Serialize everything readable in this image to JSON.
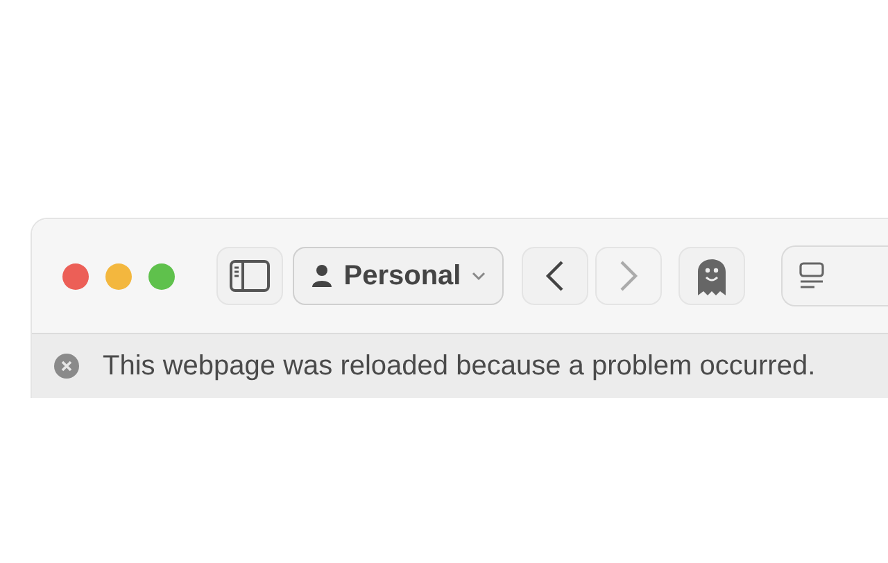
{
  "toolbar": {
    "profile": {
      "label": "Personal"
    },
    "navigation": [
      {
        "kind": "back",
        "disabled": false
      },
      {
        "kind": "forward",
        "disabled": true
      }
    ]
  },
  "banner": {
    "message": "This webpage was reloaded because a problem occurred."
  }
}
